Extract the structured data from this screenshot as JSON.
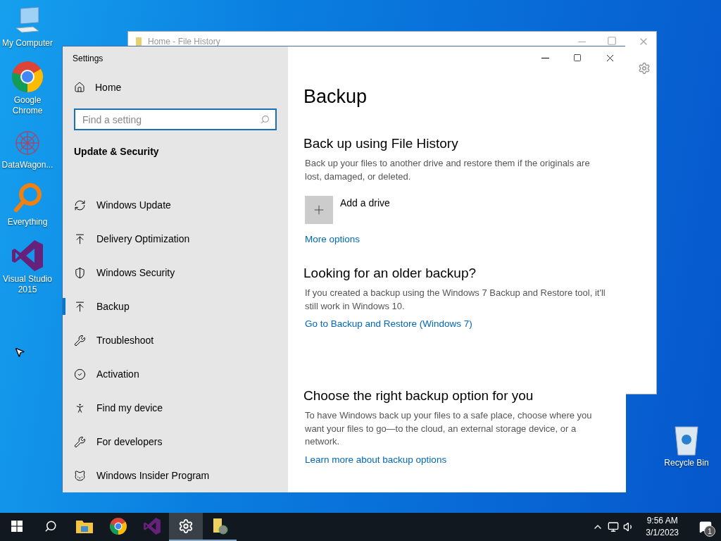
{
  "desktop_icons": [
    {
      "label": "My Computer"
    },
    {
      "label": "Google Chrome"
    },
    {
      "label": "DataWagon..."
    },
    {
      "label": "Everything"
    },
    {
      "label": "Visual Studio 2015"
    }
  ],
  "recycle_bin": {
    "label": "Recycle Bin"
  },
  "background_window": {
    "title": "Home - File History"
  },
  "settings_window": {
    "title": "Settings",
    "sidebar": {
      "home": "Home",
      "search": {
        "placeholder": "Find a setting"
      },
      "section_title": "Update & Security",
      "items": [
        {
          "label": "Windows Update",
          "selected": false
        },
        {
          "label": "Delivery Optimization",
          "selected": false
        },
        {
          "label": "Windows Security",
          "selected": false
        },
        {
          "label": "Backup",
          "selected": true
        },
        {
          "label": "Troubleshoot",
          "selected": false
        },
        {
          "label": "Activation",
          "selected": false
        },
        {
          "label": "Find my device",
          "selected": false
        },
        {
          "label": "For developers",
          "selected": false
        },
        {
          "label": "Windows Insider Program",
          "selected": false
        }
      ]
    },
    "content": {
      "title": "Backup",
      "sections": [
        {
          "heading": "Back up using File History",
          "text": "Back up your files to another drive and restore them if the originals are lost, damaged, or deleted.",
          "action": "Add a drive",
          "link": "More options"
        },
        {
          "heading": "Looking for an older backup?",
          "text": "If you created a backup using the Windows 7 Backup and Restore tool, it'll still work in Windows 10.",
          "link": "Go to Backup and Restore (Windows 7)"
        },
        {
          "heading": "Choose the right backup option for you",
          "text": "To have Windows back up your files to a safe place, choose where you want your files to go—to the cloud, an external storage device, or a network.",
          "link": "Learn more about backup options"
        }
      ]
    }
  },
  "taskbar": {
    "apps": [
      {
        "kind": "explorer",
        "open": false,
        "active": false
      },
      {
        "kind": "chrome",
        "open": false,
        "active": false
      },
      {
        "kind": "studio",
        "open": false,
        "active": false
      },
      {
        "kind": "settings",
        "open": true,
        "active": true
      },
      {
        "kind": "history",
        "open": true,
        "active": false
      }
    ],
    "time": "9:56 AM",
    "date": "3/1/2023",
    "notifications": "1"
  }
}
